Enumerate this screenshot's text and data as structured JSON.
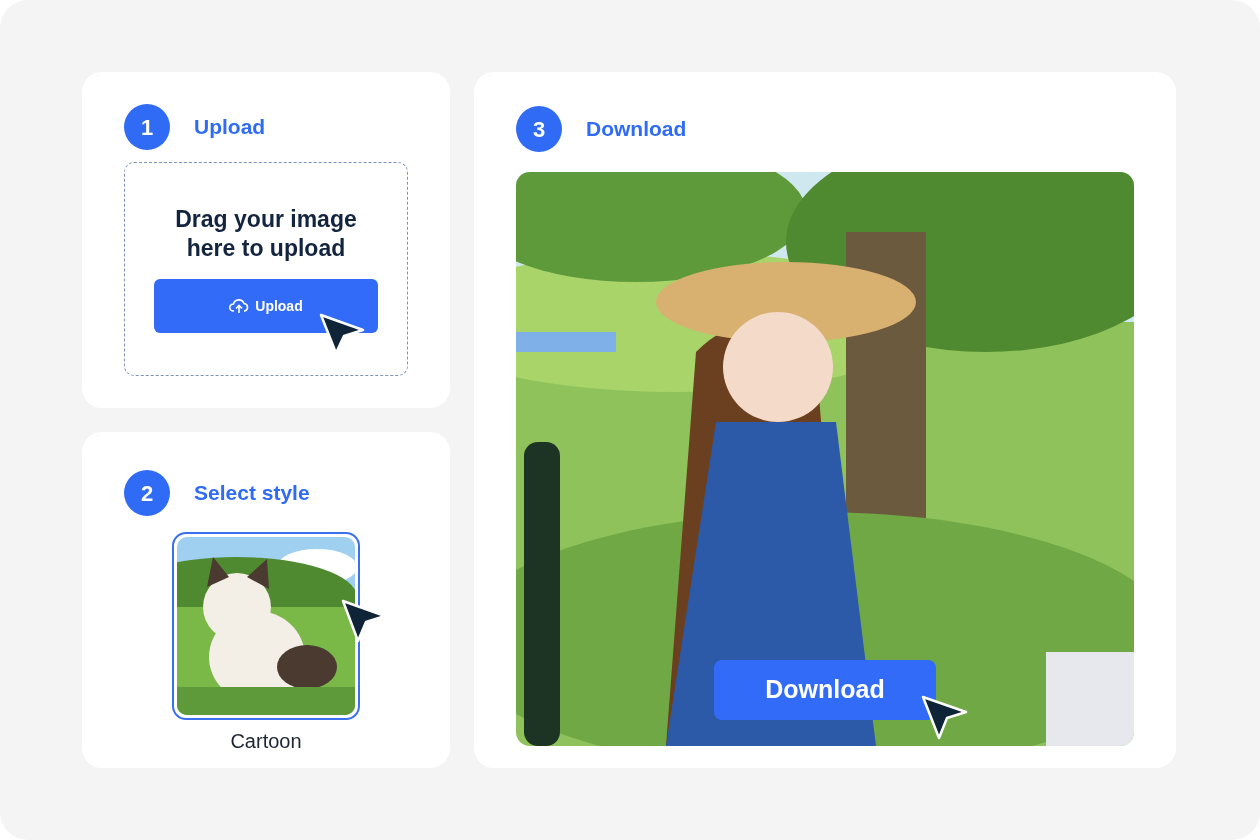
{
  "upload": {
    "number": "1",
    "title": "Upload",
    "prompt": "Drag your image here to upload",
    "button": "Upload"
  },
  "style": {
    "number": "2",
    "title": "Select style",
    "options": [
      {
        "label": "Cartoon",
        "selected": true
      }
    ]
  },
  "download": {
    "number": "3",
    "title": "Download",
    "button": "Download"
  }
}
